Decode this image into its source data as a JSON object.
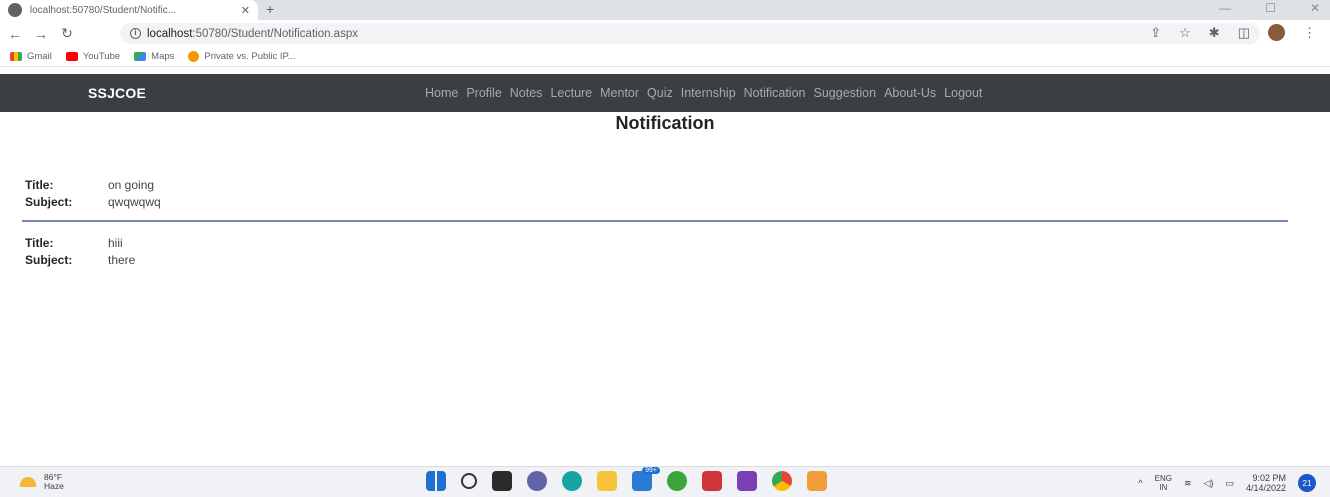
{
  "browser": {
    "tab_title": "localhost:50780/Student/Notific...",
    "tab_close": "✕",
    "new_tab": "+",
    "url_host": "localhost",
    "url_path": ":50780/Student/Notification.aspx",
    "bookmarks": [
      {
        "label": "Gmail",
        "icon": "gmail-icon"
      },
      {
        "label": "YouTube",
        "icon": "youtube-icon"
      },
      {
        "label": "Maps",
        "icon": "maps-icon"
      },
      {
        "label": "Private vs. Public IP...",
        "icon": "ip-icon"
      }
    ]
  },
  "navbar": {
    "brand": "SSJCOE",
    "links": [
      "Home",
      "Profile",
      "Notes",
      "Lecture",
      "Mentor",
      "Quiz",
      "Internship",
      "Notification",
      "Suggestion",
      "About-Us",
      "Logout"
    ]
  },
  "page": {
    "title": "Notification",
    "notifications": [
      {
        "title_label": "Title:",
        "title": "on going",
        "subject_label": "Subject:",
        "subject": "qwqwqwq"
      },
      {
        "title_label": "Title:",
        "title": "hiii",
        "subject_label": "Subject:",
        "subject": "there"
      }
    ]
  },
  "taskbar": {
    "weather_temp": "86°F",
    "weather_desc": "Haze",
    "store_badge": "99+",
    "lang_top": "ENG",
    "lang_bottom": "IN",
    "time": "9:02 PM",
    "date": "4/14/2022",
    "notif_count": "21"
  },
  "colors": {
    "navbar_bg": "#3b3f43",
    "divider": "#7d88b8"
  }
}
